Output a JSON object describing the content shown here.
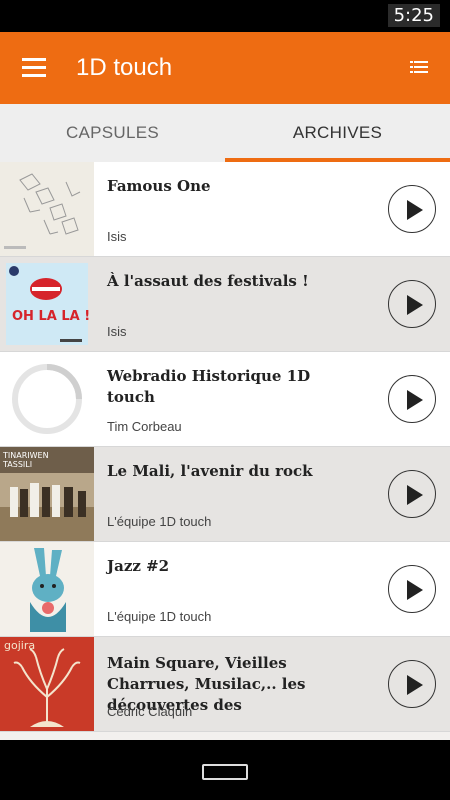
{
  "status_bar": {
    "time": "5:25"
  },
  "app_bar": {
    "title": "1D touch"
  },
  "tabs": [
    {
      "label": "CAPSULES",
      "selected": false
    },
    {
      "label": "ARCHIVES",
      "selected": true
    }
  ],
  "items": [
    {
      "title": "Famous One",
      "author": "Isis",
      "thumb": "tape-letters-artwork"
    },
    {
      "title": "À l'assaut des festivals !",
      "author": "Isis",
      "thumb": "oh-la-la-artwork",
      "cover_text": "OH LA LA !"
    },
    {
      "title": "Webradio Historique 1D touch",
      "author": "Tim Corbeau",
      "thumb": "loading-spinner"
    },
    {
      "title": "Le Mali, l'avenir du rock",
      "author": "L'équipe 1D touch",
      "thumb": "tinariwen-band-photo",
      "cover_text": "TINARIWEN TASSILI"
    },
    {
      "title": "Jazz #2",
      "author": "L'équipe 1D touch",
      "thumb": "rabbit-illustration"
    },
    {
      "title": "Main Square, Vieilles Charrues, Musilac,.. les découvertes des",
      "author": "Cédric Claquin",
      "thumb": "gojira-tree-artwork",
      "cover_text": "gojira"
    }
  ],
  "colors": {
    "accent": "#ee6c12",
    "alt_row": "#e6e4e2",
    "tab_bg": "#eeeeee"
  }
}
